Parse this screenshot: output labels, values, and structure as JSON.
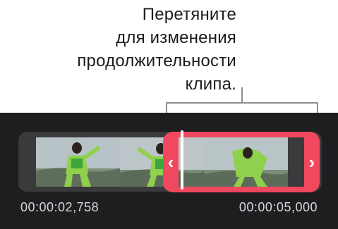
{
  "callout": {
    "lines": [
      "Перетяните",
      "для изменения",
      "продолжительности",
      "клипа."
    ]
  },
  "icons": {
    "trim_left": "‹",
    "trim_right": "›"
  },
  "timeline": {
    "start_time": "00:00:02,758",
    "end_time": "00:00:05,000"
  },
  "colors": {
    "trim_accent": "#f0485f",
    "background_dark": "#1e1e20"
  }
}
